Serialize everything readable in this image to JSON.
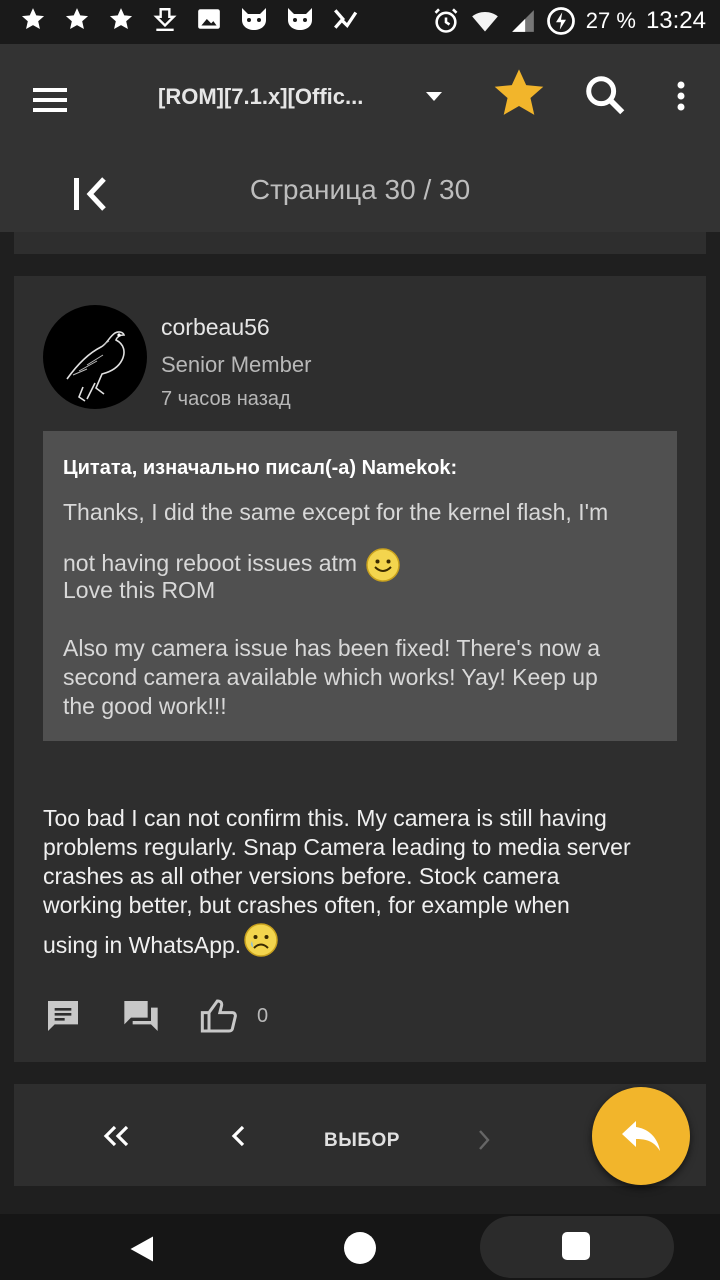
{
  "status_bar": {
    "battery_pct": "27 %",
    "time": "13:24",
    "notification_icons": [
      "star-icon",
      "star-icon",
      "star-icon",
      "download-icon",
      "image-icon",
      "cat-icon",
      "cat-icon",
      "check-icon"
    ]
  },
  "app_bar": {
    "title": "[ROM][7.1.x][Offic...",
    "page_label": "Страница 30 / 30"
  },
  "post": {
    "author": "corbeau56",
    "role": "Senior Member",
    "time": "7 часов назад",
    "quote": {
      "header": "Цитата, изначально писал(-а) Namekok:",
      "lines": [
        "Thanks, I did the same except for the kernel flash, I'm",
        "not having reboot issues atm",
        "Love this ROM",
        "Also my camera issue has been fixed! There's now a",
        "second camera available which works! Yay! Keep up",
        "the good work!!!"
      ]
    },
    "body_lines": [
      "Too bad I can not confirm this. My camera is still having",
      "problems regularly. Snap Camera leading to media server",
      "crashes as all other versions before. Stock camera",
      "working better, but crashes often, for example when",
      "using in WhatsApp."
    ],
    "like_count": "0"
  },
  "pager": {
    "select_label": "ВЫБОР"
  },
  "colors": {
    "accent": "#f2b52b",
    "card": "#2e2e2e",
    "quote_bg": "#505050",
    "app_bar": "#333333"
  }
}
